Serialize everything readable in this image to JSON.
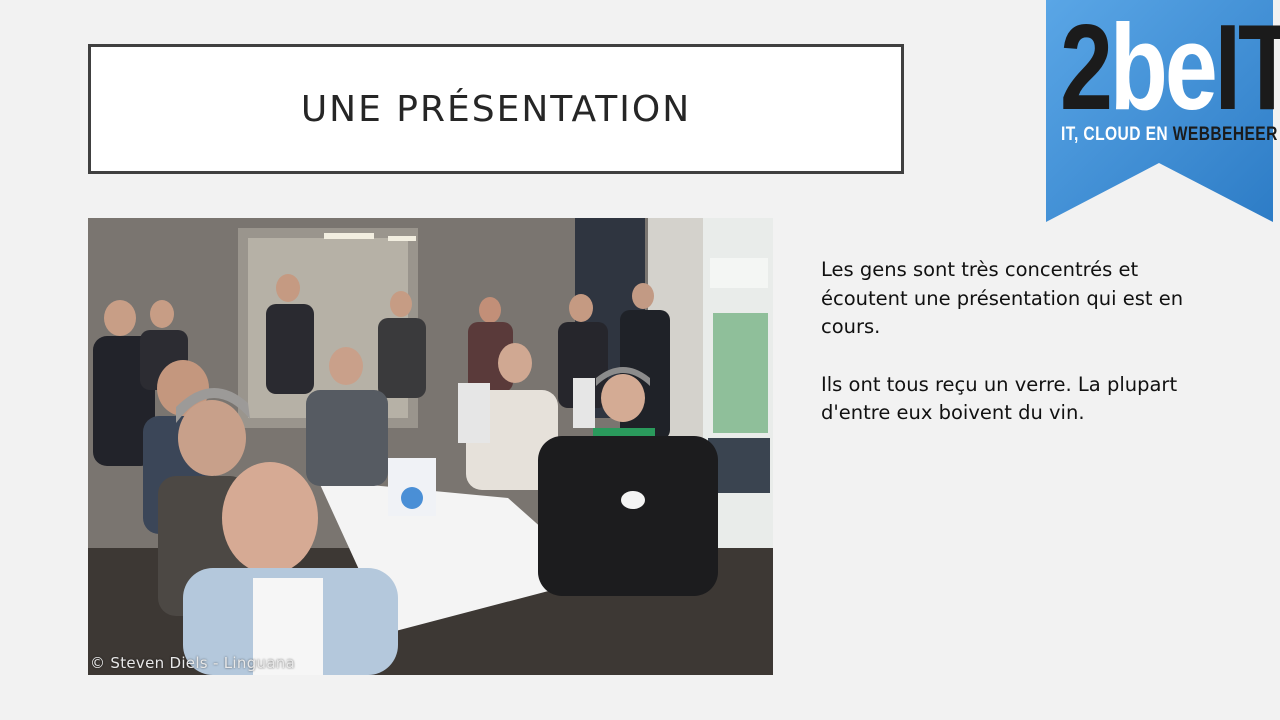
{
  "slide": {
    "title": "UNE PRÉSENTATION",
    "paragraphs": [
      "Les gens sont très concentrés et écoutent une présentation qui est en cours.",
      "Ils ont tous reçu un verre. La plupart d'entre eux boivent du vin."
    ]
  },
  "photo": {
    "credit": "© Steven Diels - Linguana"
  },
  "logo": {
    "num": "2",
    "be": "be",
    "it": "IT",
    "tagline_main": "IT, CLOUD EN ",
    "tagline_accent": "WEBBEHEER",
    "ribbon_color": "#3b8ed6"
  }
}
